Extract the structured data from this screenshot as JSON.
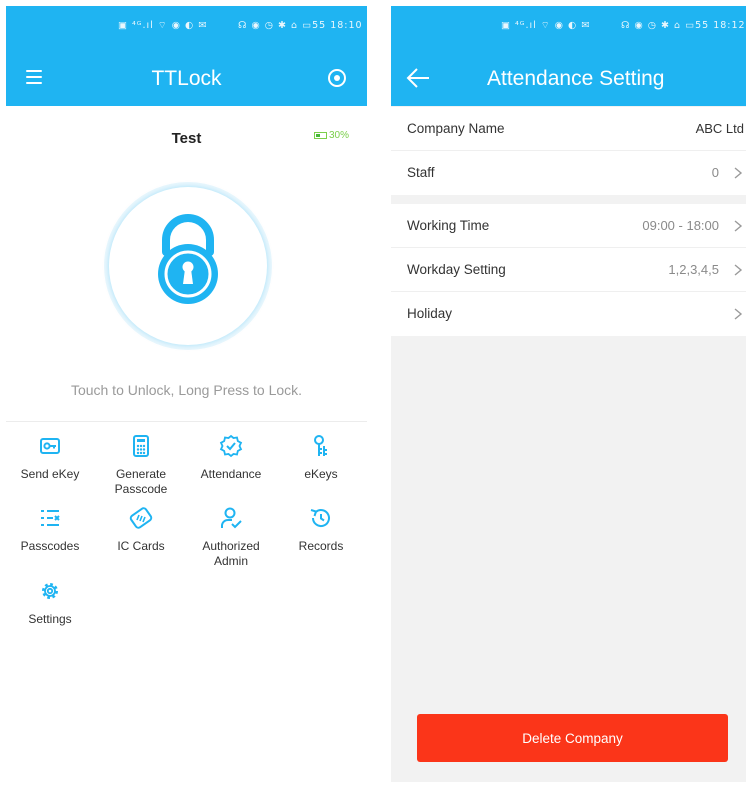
{
  "left_screen": {
    "status_left": "▣ ⁴ᴳ.ıl ⌔ ◉ ◐ ✉",
    "status_right": "☊ ◉ ◷ ✱ ⌂ ▭55 18:10",
    "title": "TTLock",
    "lock_name": "Test",
    "battery": "30%",
    "unlock_hint": "Touch to Unlock, Long Press to Lock.",
    "features": [
      {
        "label": "Send eKey",
        "icon": "send-ekey-icon"
      },
      {
        "label": "Generate Passcode",
        "icon": "generate-passcode-icon"
      },
      {
        "label": "Attendance",
        "icon": "attendance-icon"
      },
      {
        "label": "eKeys",
        "icon": "ekeys-icon"
      },
      {
        "label": "Passcodes",
        "icon": "passcodes-icon"
      },
      {
        "label": "IC Cards",
        "icon": "ic-cards-icon"
      },
      {
        "label": "Authorized Admin",
        "icon": "authorized-admin-icon"
      },
      {
        "label": "Records",
        "icon": "records-icon"
      },
      {
        "label": "Settings",
        "icon": "settings-icon"
      }
    ]
  },
  "right_screen": {
    "status_left": "▣ ⁴ᴳ.ıl ⌔ ◉ ◐ ✉",
    "status_right": "☊ ◉ ◷ ✱ ⌂ ▭55 18:12",
    "title": "Attendance Setting",
    "company_name_label": "Company Name",
    "company_name_value": "ABC Ltd",
    "staff_label": "Staff",
    "staff_value": "0",
    "working_time_label": "Working Time",
    "working_time_value": "09:00 - 18:00",
    "workday_label": "Workday Setting",
    "workday_value": "1,2,3,4,5",
    "holiday_label": "Holiday",
    "delete_button": "Delete Company"
  },
  "colors": {
    "header_blue": "#1fb4f2",
    "delete_red": "#fb3519",
    "battery_green": "#47b935",
    "background_gray": "#f2f2f2"
  }
}
